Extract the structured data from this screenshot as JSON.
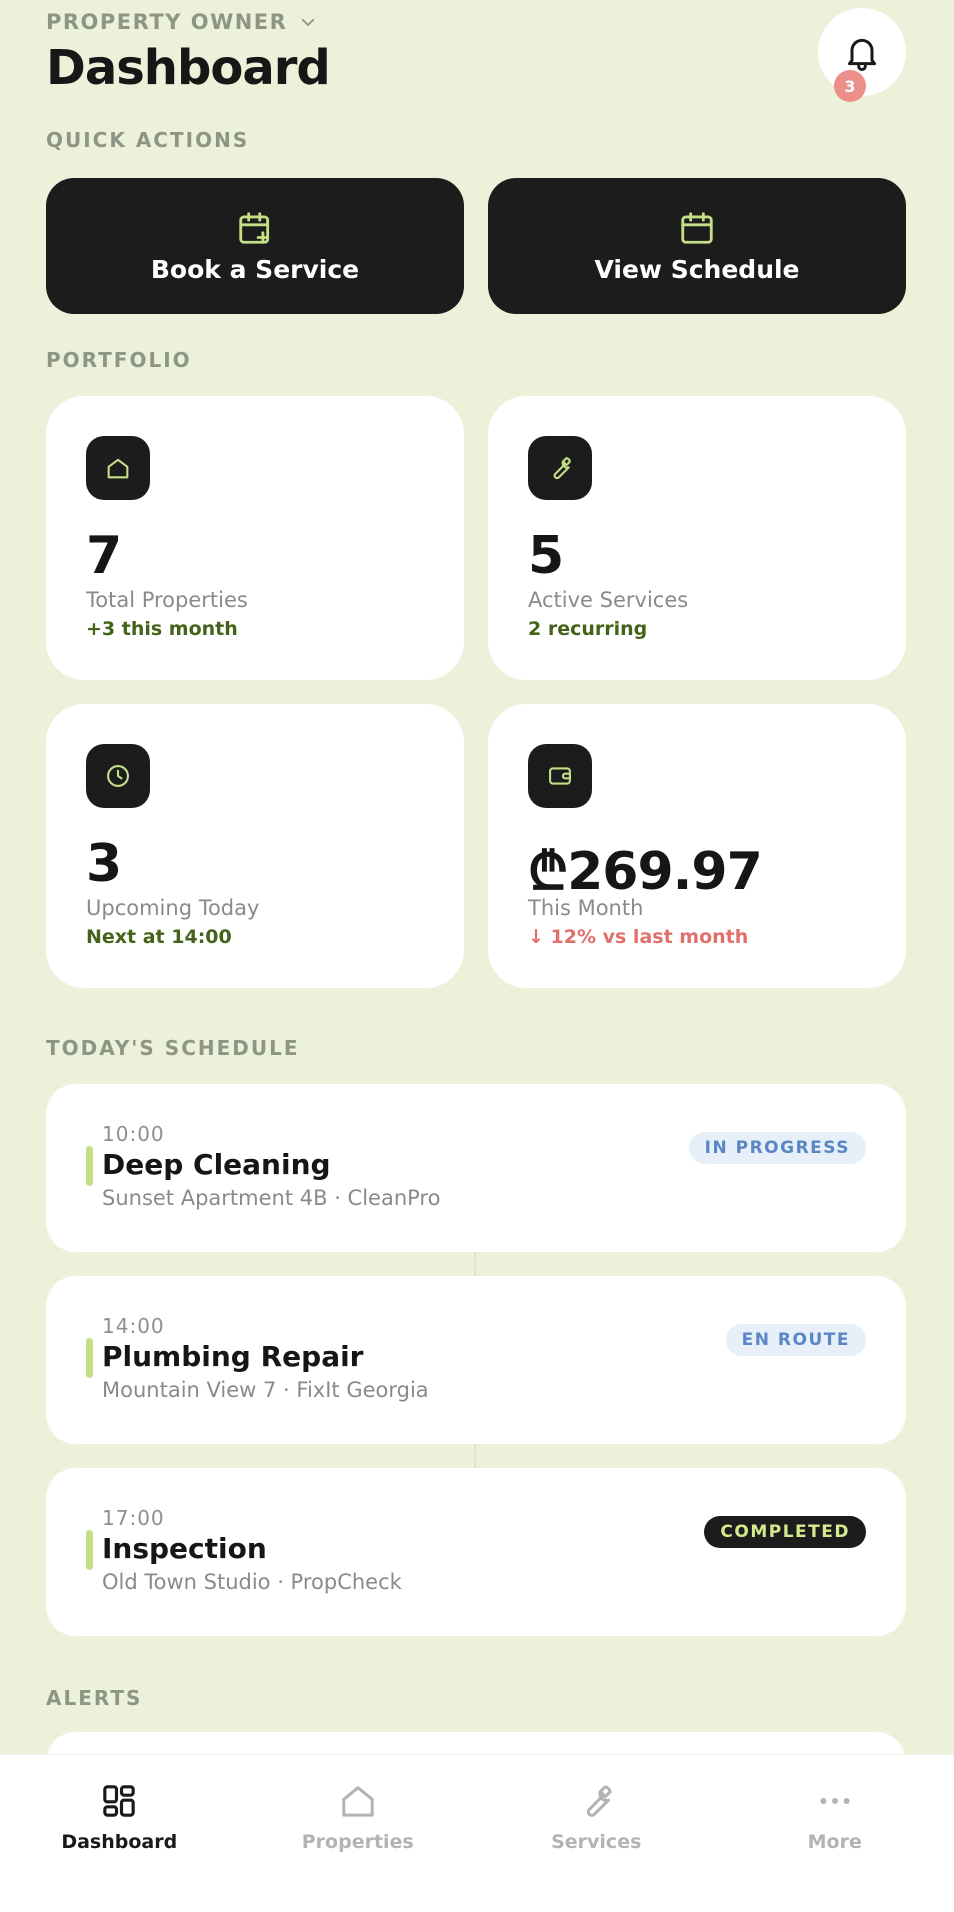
{
  "header": {
    "role": "PROPERTY OWNER",
    "title": "Dashboard",
    "notifications": "3"
  },
  "sections": {
    "quick_actions": "QUICK ACTIONS",
    "portfolio": "PORTFOLIO",
    "schedule": "TODAY'S SCHEDULE",
    "alerts": "ALERTS"
  },
  "quick_actions": [
    {
      "label": "Book a Service",
      "icon": "calendar-plus-icon"
    },
    {
      "label": "View Schedule",
      "icon": "calendar-icon"
    }
  ],
  "stats": [
    {
      "icon": "home-icon",
      "value": "7",
      "label": "Total Properties",
      "sub": "+3 this month"
    },
    {
      "icon": "wrench-icon",
      "value": "5",
      "label": "Active Services",
      "sub": "2 recurring"
    },
    {
      "icon": "clock-icon",
      "value": "3",
      "label": "Upcoming Today",
      "sub": "Next at 14:00"
    },
    {
      "icon": "wallet-icon",
      "value": "₾269.97",
      "label": "This Month",
      "sub": "↓ 12% vs last month"
    }
  ],
  "schedule": [
    {
      "time": "10:00",
      "title": "Deep Cleaning",
      "subtitle": "Sunset Apartment 4B · CleanPro",
      "status": "IN PROGRESS"
    },
    {
      "time": "14:00",
      "title": "Plumbing Repair",
      "subtitle": "Mountain View 7 · FixIt Georgia",
      "status": "EN ROUTE"
    },
    {
      "time": "17:00",
      "title": "Inspection",
      "subtitle": "Old Town Studio · PropCheck",
      "status": "COMPLETED"
    }
  ],
  "nav": [
    {
      "label": "Dashboard",
      "icon": "grid-icon",
      "active": true
    },
    {
      "label": "Properties",
      "icon": "home-icon"
    },
    {
      "label": "Services",
      "icon": "wrench-icon"
    },
    {
      "label": "More",
      "icon": "more-icon"
    }
  ],
  "colors": {
    "background": "#ecf2da",
    "accent": "#c5df86",
    "dark": "#1c1c1c",
    "positive": "#44631a",
    "negative": "#e0706a"
  }
}
